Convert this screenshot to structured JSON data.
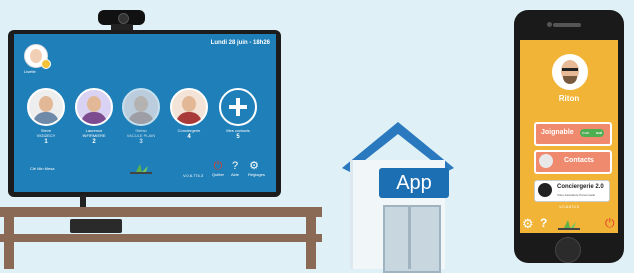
{
  "tv": {
    "date_time": "Lundi 28 juin - 18h26",
    "user_name": "Lisette",
    "contacts": [
      {
        "name": "Steve\nVIGIZECY",
        "number": "1"
      },
      {
        "name": "Laurence\nINFIRMIERE",
        "number": "2"
      },
      {
        "name": "Stefan\nVACULE PLAIN",
        "number": "3"
      },
      {
        "name": "Conciergerie",
        "number": "4"
      },
      {
        "name": "Mes contacts",
        "number": "5"
      }
    ],
    "bottom_left_label": "Clé  Min  Mesa",
    "version": "V.0.6.774.3",
    "icons": [
      {
        "label": "Quitter",
        "icon": "power-icon"
      },
      {
        "label": "Aide",
        "icon": "help-icon"
      },
      {
        "label": "Réglages",
        "icon": "gear-icon"
      }
    ]
  },
  "house": {
    "sign": "App"
  },
  "phone": {
    "name": "Riton",
    "joignable_label": "Joignable",
    "toggle_off": "non",
    "toggle_on": "oui",
    "contacts_label": "Contacts",
    "concierge_title": "Conciergerie 2.0",
    "concierge_subtitle": "Votre Assistante Personnelle",
    "version": "V.0.6.674.0"
  }
}
